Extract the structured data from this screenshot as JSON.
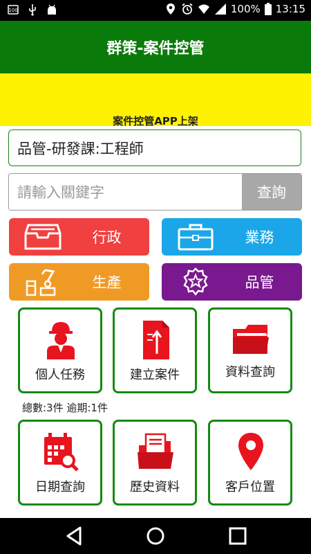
{
  "status_bar": {
    "battery": "100%",
    "time": "13:15"
  },
  "app_bar": {
    "title": "群策-案件控管"
  },
  "banner": {
    "text": "案件控管APP上架"
  },
  "department": {
    "label": "品管-研發課:工程師"
  },
  "search": {
    "placeholder": "請輸入關鍵字",
    "button_label": "查詢"
  },
  "categories": [
    {
      "label": "行政",
      "color": "#f04040",
      "icon": "drawer-icon"
    },
    {
      "label": "業務",
      "color": "#1aa6e8",
      "icon": "briefcase-icon"
    },
    {
      "label": "生產",
      "color": "#f09a26",
      "icon": "robot-arm-icon"
    },
    {
      "label": "品管",
      "color": "#7a1890",
      "icon": "star-badge-icon"
    }
  ],
  "tiles_top": [
    {
      "label": "個人任務",
      "icon": "worker-icon"
    },
    {
      "label": "建立案件",
      "icon": "new-document-icon"
    },
    {
      "label": "資料查詢",
      "icon": "folder-icon"
    }
  ],
  "summary": {
    "text": "總數:3件 逾期:1件"
  },
  "tiles_bottom": [
    {
      "label": "日期查詢",
      "icon": "calendar-search-icon"
    },
    {
      "label": "歷史資料",
      "icon": "document-folder-icon"
    },
    {
      "label": "客戶位置",
      "icon": "location-pin-icon"
    }
  ],
  "colors": {
    "app_bar": "#0a7a0a",
    "banner": "#fff200",
    "tile_border": "#138a13",
    "icon_red": "#e8141e"
  }
}
